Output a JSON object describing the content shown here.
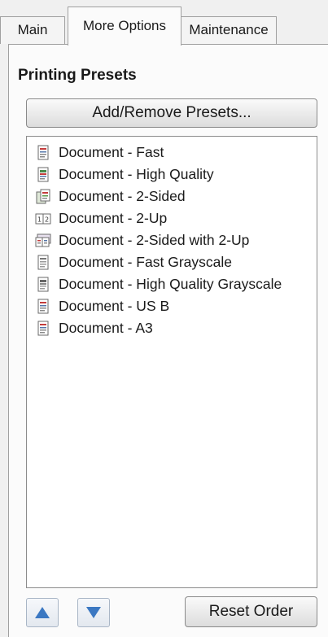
{
  "tabs": [
    {
      "label": "Main",
      "active": false
    },
    {
      "label": "More Options",
      "active": true
    },
    {
      "label": "Maintenance",
      "active": false
    }
  ],
  "section_title": "Printing Presets",
  "add_remove_button": "Add/Remove Presets...",
  "presets": [
    {
      "label": "Document - Fast",
      "icon": "document-icon"
    },
    {
      "label": "Document - High Quality",
      "icon": "document-icon"
    },
    {
      "label": "Document - 2-Sided",
      "icon": "two-sided-icon"
    },
    {
      "label": "Document - 2-Up",
      "icon": "two-up-icon"
    },
    {
      "label": "Document - 2-Sided with 2-Up",
      "icon": "two-sided-two-up-icon"
    },
    {
      "label": "Document - Fast Grayscale",
      "icon": "grayscale-document-icon"
    },
    {
      "label": "Document - High Quality Grayscale",
      "icon": "grayscale-document-icon"
    },
    {
      "label": "Document - US B",
      "icon": "document-icon"
    },
    {
      "label": "Document - A3",
      "icon": "document-icon"
    }
  ],
  "reset_order_button": "Reset Order",
  "colors": {
    "arrow_blue": "#3b78c2",
    "panel_bg": "#fbfbfb",
    "window_bg": "#f0f0f0"
  }
}
